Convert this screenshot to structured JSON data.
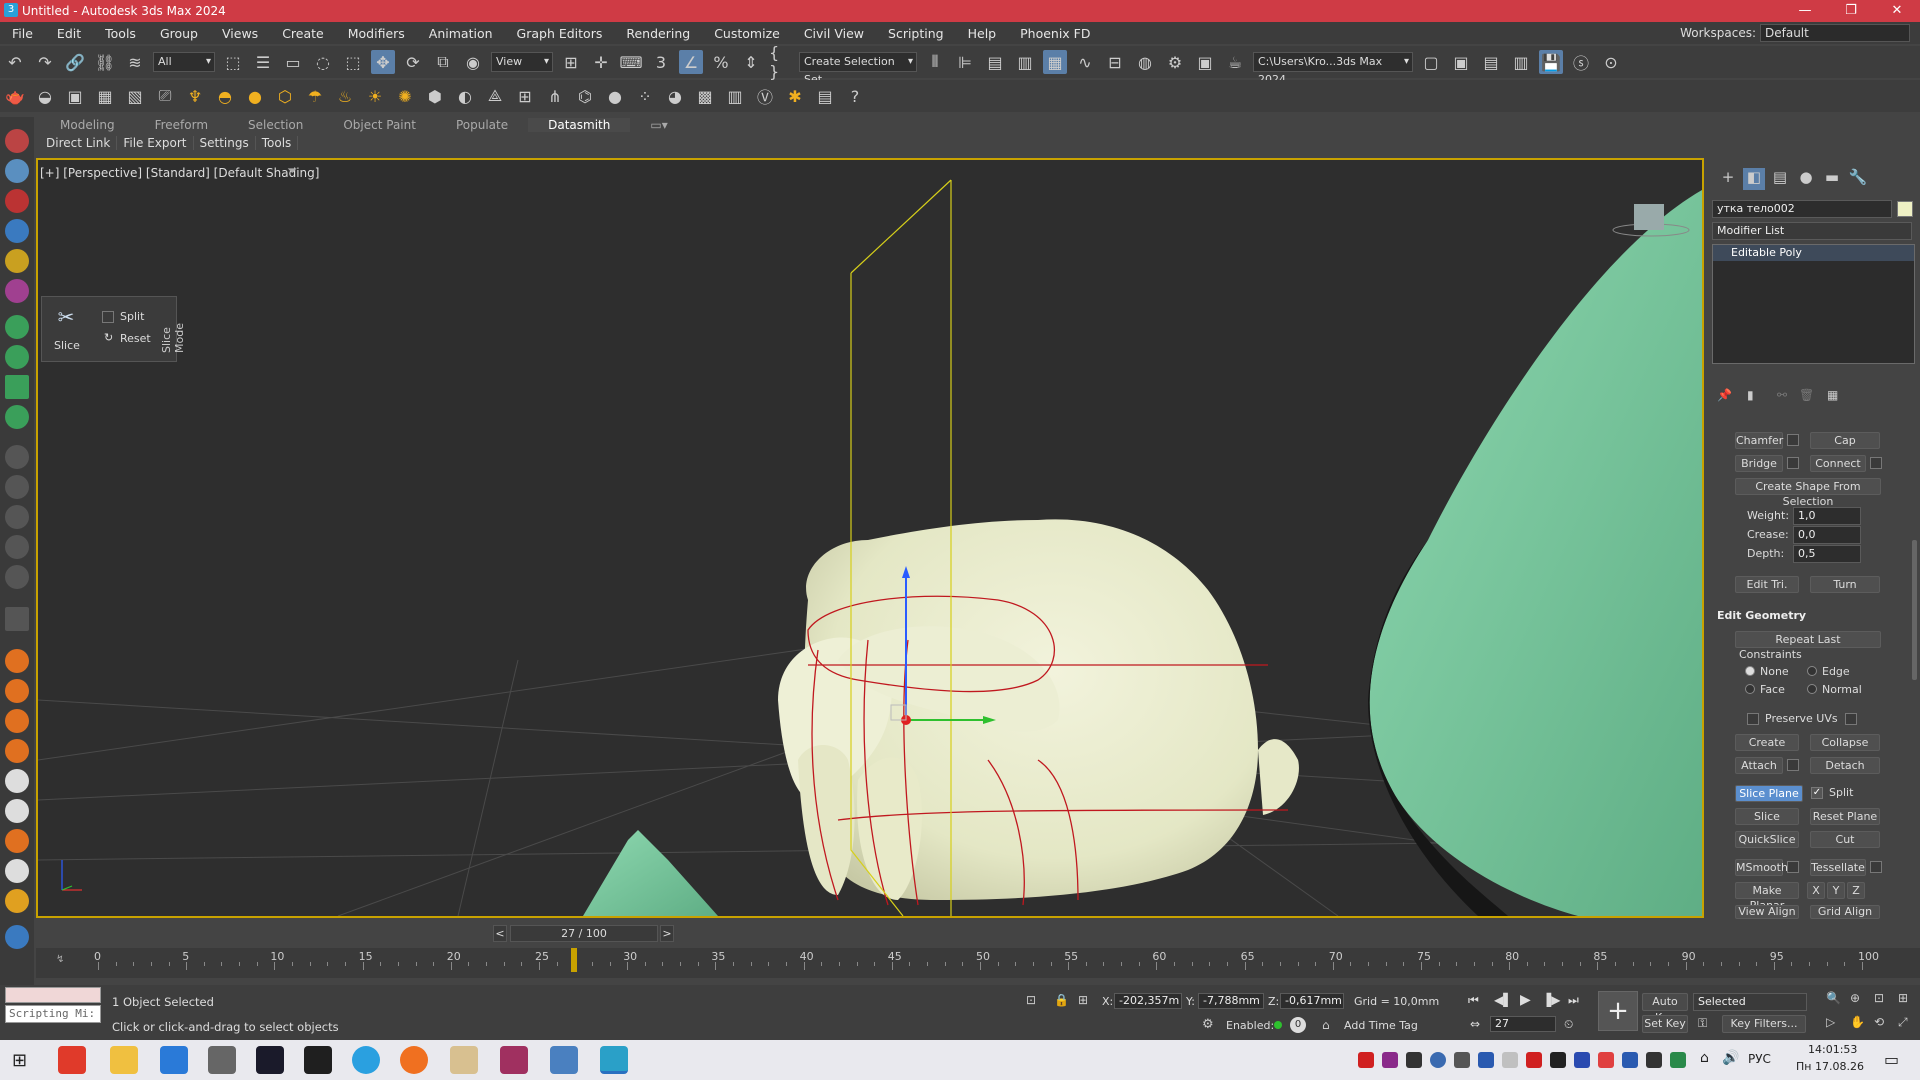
{
  "window": {
    "title": "Untitled - Autodesk 3ds Max 2024",
    "min": "—",
    "max": "❐",
    "close": "✕"
  },
  "menu": [
    "File",
    "Edit",
    "Tools",
    "Group",
    "Views",
    "Create",
    "Modifiers",
    "Animation",
    "Graph Editors",
    "Rendering",
    "Customize",
    "Civil View",
    "Scripting",
    "Help",
    "Phoenix FD"
  ],
  "workspaces": {
    "label": "Workspaces:",
    "value": "Default"
  },
  "toolbar1": {
    "filter": "All",
    "view": "View",
    "selection_set": "Create Selection Set",
    "path": "C:\\Users\\Kro...3ds Max 2024"
  },
  "ribbon": {
    "tabs": [
      "Modeling",
      "Freeform",
      "Selection",
      "Object Paint",
      "Populate",
      "Datasmith"
    ],
    "active": "Datasmith",
    "subtabs": [
      "Direct Link",
      "File Export",
      "Settings",
      "Tools"
    ]
  },
  "viewport": {
    "label": "[+] [Perspective] [Standard] [Default Shading]"
  },
  "caddy": {
    "slice": "Slice",
    "split": "Split",
    "reset": "Reset",
    "mode": "Slice Mode"
  },
  "panel": {
    "object_name": "утка тело002",
    "modifier_list": "Modifier List",
    "stack_item": "Editable Poly",
    "buttons_top": {
      "chamfer": "Chamfer",
      "cap": "Cap",
      "bridge": "Bridge",
      "connect": "Connect",
      "create_shape": "Create Shape From Selection"
    },
    "weight": {
      "label": "Weight:",
      "value": "1,0"
    },
    "crease": {
      "label": "Crease:",
      "value": "0,0"
    },
    "depth": {
      "label": "Depth:",
      "value": "0,5"
    },
    "edit_tri": "Edit Tri.",
    "turn": "Turn",
    "edit_geometry": "Edit Geometry",
    "repeat_last": "Repeat Last",
    "constraints": "Constraints",
    "c_none": "None",
    "c_edge": "Edge",
    "c_face": "Face",
    "c_normal": "Normal",
    "preserve_uvs": "Preserve UVs",
    "create": "Create",
    "collapse": "Collapse",
    "attach": "Attach",
    "detach": "Detach",
    "slice_plane": "Slice Plane",
    "split": "Split",
    "slice": "Slice",
    "reset_plane": "Reset Plane",
    "quickslice": "QuickSlice",
    "cut": "Cut",
    "msmooth": "MSmooth",
    "tessellate": "Tessellate",
    "make_planar": "Make Planar",
    "x": "X",
    "y": "Y",
    "z": "Z",
    "view_align": "View Align",
    "grid_align": "Grid Align"
  },
  "timeline": {
    "slider": "27 / 100",
    "prev": "<",
    "next": ">",
    "ticks": [
      "0",
      "5",
      "10",
      "15",
      "20",
      "25",
      "30",
      "35",
      "40",
      "45",
      "50",
      "55",
      "60",
      "65",
      "70",
      "75",
      "80",
      "85",
      "90",
      "95",
      "100"
    ],
    "current_frame": 27
  },
  "status": {
    "script_box": "Scripting Mi:",
    "selected": "1 Object Selected",
    "prompt": "Click or click-and-drag to select objects",
    "x_label": "X:",
    "x": "-202,357m",
    "y_label": "Y:",
    "y": "-7,788mm",
    "z_label": "Z:",
    "z": "-0,617mm",
    "grid": "Grid = 10,0mm",
    "enabled": "Enabled:",
    "add_time_tag": "Add Time Tag",
    "auto_key": "Auto Key",
    "set_key": "Set Key",
    "key_mode": "Selected",
    "key_filters": "Key Filters...",
    "frame": "27"
  },
  "taskbar": {
    "lang": "РУС",
    "time": "14:01:53",
    "date": "Пн 17.08.26"
  },
  "colors": {
    "accent": "#5b8fcf",
    "titlebar": "#cf3b45",
    "viewport_border": "#c8a200",
    "object_color": "#e6e9c9",
    "green_object": "#7fd0a6"
  }
}
